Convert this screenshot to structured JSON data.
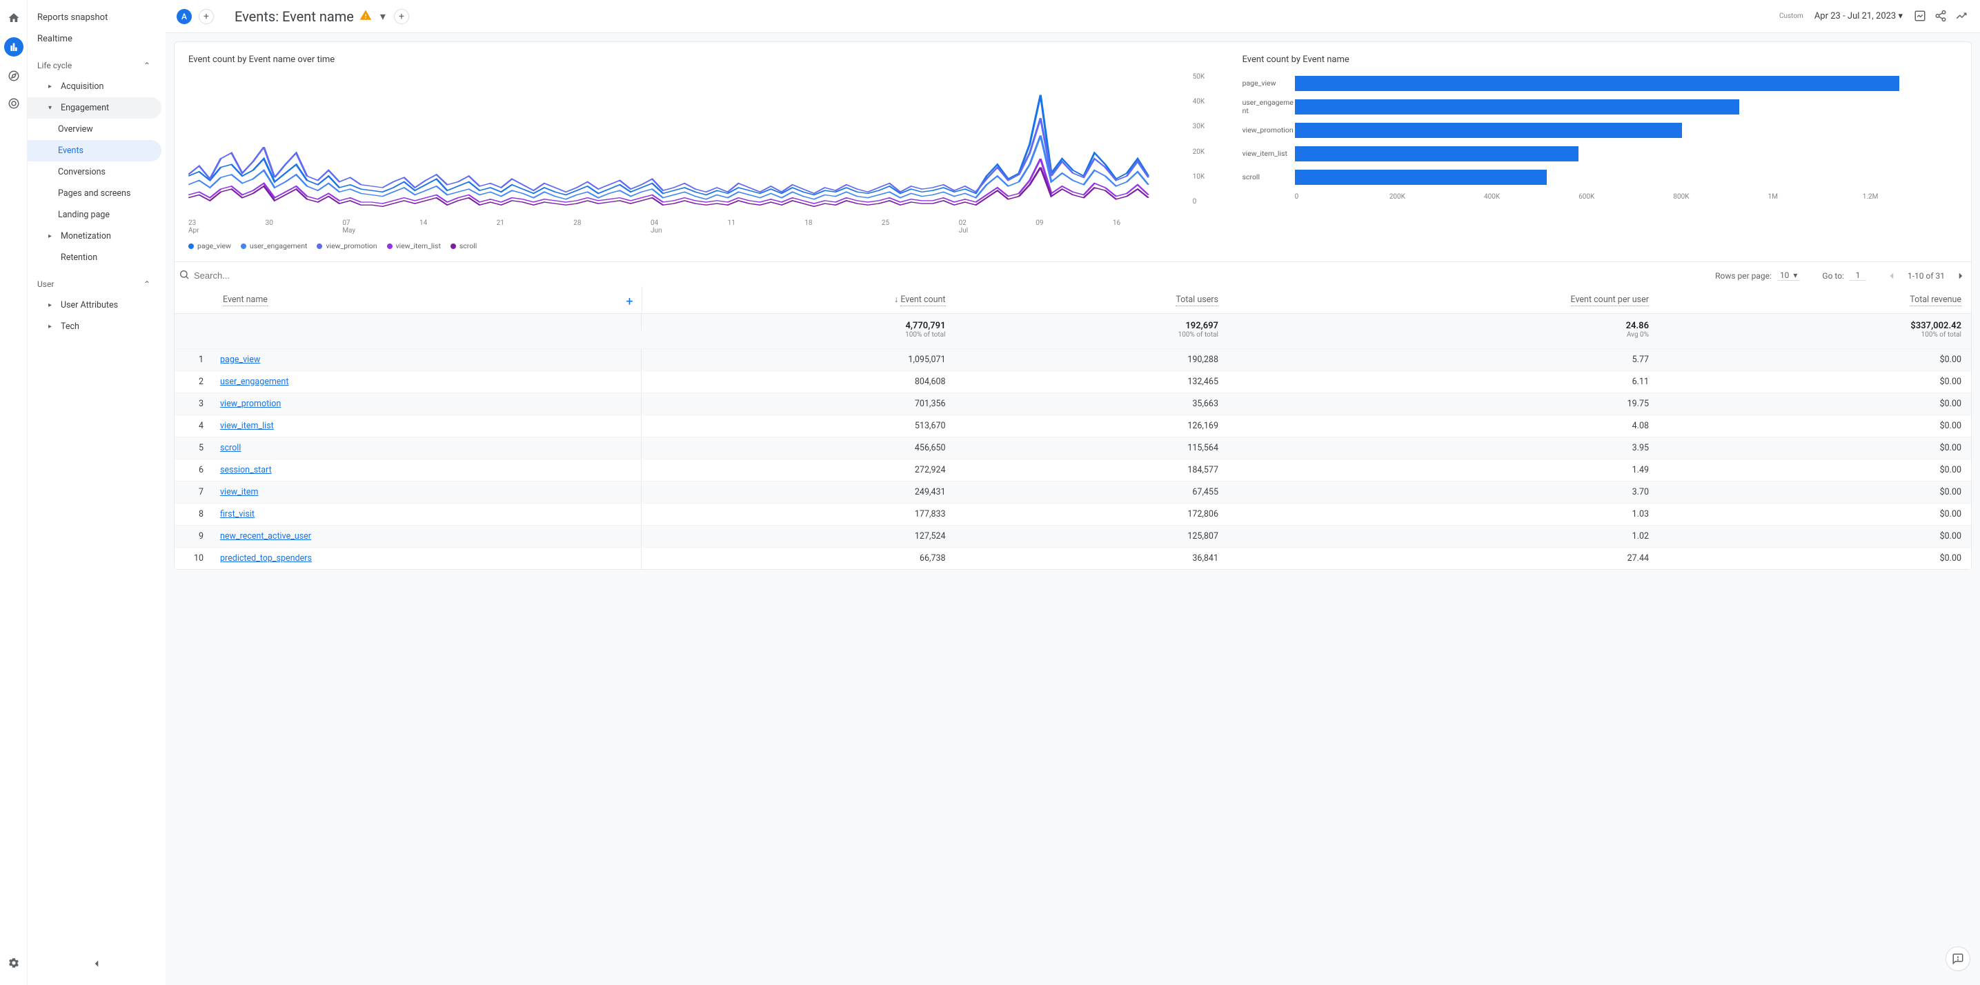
{
  "rail": {
    "icons": [
      "home",
      "reports",
      "explore",
      "advertising"
    ],
    "active": 1
  },
  "sidebar": {
    "top": {
      "snapshot": "Reports snapshot",
      "realtime": "Realtime"
    },
    "sections": {
      "lifecycle": {
        "label": "Life cycle",
        "acquisition": "Acquisition",
        "engagement": {
          "label": "Engagement",
          "overview": "Overview",
          "events": "Events",
          "conversions": "Conversions",
          "pages": "Pages and screens",
          "landing": "Landing page"
        },
        "monetization": "Monetization",
        "retention": "Retention"
      },
      "user": {
        "label": "User",
        "attributes": "User Attributes",
        "tech": "Tech"
      }
    }
  },
  "header": {
    "segment_chip": "A",
    "title": "Events: Event name",
    "date_label": "Custom",
    "date_range": "Apr 23 - Jul 21, 2023"
  },
  "line_chart_title": "Event count by Event name over time",
  "bar_chart_title": "Event count by Event name",
  "legend": [
    "page_view",
    "user_engagement",
    "view_promotion",
    "view_item_list",
    "scroll"
  ],
  "legend_colors": [
    "#1a73e8",
    "#4285f4",
    "#5e6bf2",
    "#9334e6",
    "#7b1fa2"
  ],
  "chart_data": [
    {
      "type": "line",
      "title": "Event count by Event name over time",
      "ylabel": "",
      "xlabel": "",
      "ylim": [
        0,
        50000
      ],
      "y_ticks": [
        "50K",
        "40K",
        "30K",
        "20K",
        "10K",
        "0"
      ],
      "x_ticks": [
        {
          "d": "23",
          "m": "Apr"
        },
        {
          "d": "30",
          "m": ""
        },
        {
          "d": "07",
          "m": "May"
        },
        {
          "d": "14",
          "m": ""
        },
        {
          "d": "21",
          "m": ""
        },
        {
          "d": "28",
          "m": ""
        },
        {
          "d": "04",
          "m": "Jun"
        },
        {
          "d": "11",
          "m": ""
        },
        {
          "d": "18",
          "m": ""
        },
        {
          "d": "25",
          "m": ""
        },
        {
          "d": "02",
          "m": "Jul"
        },
        {
          "d": "09",
          "m": ""
        },
        {
          "d": "16",
          "m": ""
        }
      ],
      "series": [
        {
          "name": "page_view",
          "color": "#1a73e8",
          "values": [
            14000,
            15500,
            12500,
            17000,
            18000,
            14000,
            16000,
            20000,
            12000,
            15000,
            18000,
            12500,
            11000,
            14000,
            10000,
            11000,
            9500,
            9000,
            8500,
            10000,
            12000,
            9000,
            11000,
            13000,
            9000,
            10500,
            12000,
            9000,
            10000,
            8500,
            11000,
            9500,
            8000,
            10000,
            8500,
            7500,
            9000,
            10500,
            8000,
            9500,
            11000,
            8500,
            10000,
            11500,
            8000,
            9000,
            10000,
            8500,
            7500,
            9000,
            8000,
            10000,
            9000,
            8000,
            9500,
            8000,
            10000,
            8500,
            7500,
            9000,
            8500,
            10000,
            8500,
            8000,
            9000,
            10500,
            8000,
            9500,
            8500,
            9000,
            10000,
            8500,
            9500,
            8000,
            14000,
            18000,
            13000,
            15000,
            25000,
            42000,
            15000,
            20000,
            16000,
            14000,
            22000,
            18000,
            13000,
            15000,
            20000,
            14000
          ]
        },
        {
          "name": "user_engagement",
          "color": "#4285f4",
          "values": [
            11000,
            12500,
            10000,
            13500,
            14500,
            11500,
            13000,
            16000,
            10000,
            12000,
            14500,
            10500,
            9000,
            11500,
            8500,
            9500,
            8000,
            7500,
            7000,
            8500,
            10000,
            7500,
            9000,
            10500,
            7500,
            8500,
            9500,
            7500,
            8500,
            7000,
            9000,
            8000,
            6500,
            8500,
            7000,
            6000,
            7500,
            8500,
            6500,
            8000,
            9000,
            7000,
            8500,
            9500,
            6500,
            7500,
            8500,
            7000,
            6000,
            7500,
            6500,
            8500,
            7500,
            6500,
            8000,
            6500,
            8500,
            7000,
            6000,
            7500,
            7000,
            8500,
            7000,
            6500,
            7500,
            8500,
            6500,
            8000,
            7000,
            7500,
            8500,
            7000,
            8000,
            6500,
            11000,
            14000,
            10500,
            12000,
            18000,
            28000,
            12000,
            15000,
            12500,
            11000,
            16000,
            14000,
            10500,
            12000,
            15500,
            11000
          ]
        },
        {
          "name": "view_promotion",
          "color": "#5e6bf2",
          "values": [
            14500,
            17500,
            13000,
            20000,
            22000,
            15000,
            19000,
            24000,
            13500,
            18000,
            22000,
            14000,
            12500,
            16000,
            12000,
            13500,
            11000,
            10500,
            10000,
            12000,
            13500,
            10000,
            12500,
            14500,
            11000,
            12000,
            14000,
            10500,
            11500,
            10000,
            13000,
            11000,
            9000,
            11500,
            10000,
            8500,
            10000,
            12000,
            9500,
            11000,
            12500,
            9500,
            11000,
            13000,
            9000,
            10000,
            11500,
            9500,
            8500,
            10000,
            8500,
            11500,
            10000,
            8500,
            10500,
            8500,
            11000,
            9500,
            8000,
            10000,
            9000,
            11000,
            9500,
            8500,
            10000,
            11500,
            8500,
            10500,
            9500,
            10000,
            11000,
            9000,
            10500,
            8500,
            13000,
            17000,
            12500,
            14500,
            22000,
            34000,
            14000,
            19000,
            15000,
            13500,
            20000,
            17000,
            12500,
            14000,
            19000,
            13500
          ]
        },
        {
          "name": "view_item_list",
          "color": "#9334e6",
          "values": [
            7500,
            8500,
            6500,
            9500,
            10500,
            7500,
            9000,
            11500,
            6500,
            8500,
            10500,
            7000,
            6000,
            8000,
            5500,
            6500,
            5000,
            5000,
            4500,
            5500,
            6500,
            5500,
            6500,
            7500,
            5000,
            6500,
            7500,
            5000,
            6000,
            5000,
            6500,
            6000,
            5000,
            6000,
            5500,
            5000,
            5500,
            6500,
            5500,
            6000,
            6500,
            5500,
            6500,
            7500,
            5000,
            5500,
            6500,
            5500,
            5000,
            5500,
            5000,
            6500,
            5500,
            5000,
            6000,
            5000,
            6500,
            5500,
            4500,
            5500,
            5000,
            6500,
            5500,
            5000,
            5500,
            6500,
            5000,
            6000,
            5500,
            5500,
            6500,
            5000,
            6000,
            5000,
            7500,
            10000,
            7000,
            8000,
            12500,
            20000,
            8000,
            10500,
            8500,
            7500,
            11500,
            10000,
            7000,
            8000,
            11000,
            7500
          ]
        },
        {
          "name": "scroll",
          "color": "#7b1fa2",
          "values": [
            6500,
            7500,
            5500,
            8500,
            9500,
            6500,
            8000,
            10500,
            5500,
            7500,
            9500,
            6000,
            5000,
            7000,
            4500,
            5500,
            4000,
            4000,
            3500,
            4500,
            5500,
            4500,
            5500,
            6500,
            4000,
            5500,
            6500,
            4000,
            5000,
            4000,
            5500,
            5000,
            4000,
            5000,
            4500,
            4000,
            4500,
            5500,
            4500,
            5000,
            5500,
            4500,
            5500,
            6500,
            4000,
            4500,
            5500,
            4500,
            4000,
            4500,
            4000,
            5500,
            4500,
            4000,
            5000,
            4000,
            5500,
            4500,
            3500,
            4500,
            4000,
            5500,
            4500,
            4000,
            4500,
            5500,
            4000,
            5000,
            4500,
            4500,
            5500,
            4000,
            5000,
            4000,
            6500,
            9000,
            6000,
            7000,
            11000,
            17000,
            7000,
            9500,
            7500,
            6500,
            10000,
            9000,
            6000,
            7000,
            9500,
            6500
          ]
        }
      ]
    },
    {
      "type": "bar",
      "title": "Event count by Event name",
      "orientation": "horizontal",
      "xlim": [
        0,
        1200000
      ],
      "x_ticks": [
        "0",
        "200K",
        "400K",
        "600K",
        "800K",
        "1M",
        "1.2M"
      ],
      "categories": [
        "page_view",
        "user_engagement",
        "view_promotion",
        "view_item_list",
        "scroll"
      ],
      "values": [
        1095071,
        804608,
        701356,
        513670,
        456650
      ]
    }
  ],
  "table": {
    "search_placeholder": "Search...",
    "rows_per_page_label": "Rows per page:",
    "rows_per_page_value": "10",
    "goto_label": "Go to:",
    "goto_value": "1",
    "range_text": "1-10 of 31",
    "columns": [
      "Event name",
      "Event count",
      "Total users",
      "Event count per user",
      "Total revenue"
    ],
    "sort_icon_col": 1,
    "totals": {
      "event_count": {
        "val": "4,770,791",
        "sub": "100% of total"
      },
      "total_users": {
        "val": "192,697",
        "sub": "100% of total"
      },
      "per_user": {
        "val": "24.86",
        "sub": "Avg 0%"
      },
      "revenue": {
        "val": "$337,002.42",
        "sub": "100% of total"
      }
    },
    "rows": [
      {
        "n": 1,
        "name": "page_view",
        "ec": "1,095,071",
        "tu": "190,288",
        "pu": "5.77",
        "rev": "$0.00"
      },
      {
        "n": 2,
        "name": "user_engagement",
        "ec": "804,608",
        "tu": "132,465",
        "pu": "6.11",
        "rev": "$0.00"
      },
      {
        "n": 3,
        "name": "view_promotion",
        "ec": "701,356",
        "tu": "35,663",
        "pu": "19.75",
        "rev": "$0.00"
      },
      {
        "n": 4,
        "name": "view_item_list",
        "ec": "513,670",
        "tu": "126,169",
        "pu": "4.08",
        "rev": "$0.00"
      },
      {
        "n": 5,
        "name": "scroll",
        "ec": "456,650",
        "tu": "115,564",
        "pu": "3.95",
        "rev": "$0.00"
      },
      {
        "n": 6,
        "name": "session_start",
        "ec": "272,924",
        "tu": "184,577",
        "pu": "1.49",
        "rev": "$0.00"
      },
      {
        "n": 7,
        "name": "view_item",
        "ec": "249,431",
        "tu": "67,455",
        "pu": "3.70",
        "rev": "$0.00"
      },
      {
        "n": 8,
        "name": "first_visit",
        "ec": "177,833",
        "tu": "172,806",
        "pu": "1.03",
        "rev": "$0.00"
      },
      {
        "n": 9,
        "name": "new_recent_active_user",
        "ec": "127,524",
        "tu": "125,807",
        "pu": "1.02",
        "rev": "$0.00"
      },
      {
        "n": 10,
        "name": "predicted_top_spenders",
        "ec": "66,738",
        "tu": "36,841",
        "pu": "27.44",
        "rev": "$0.00"
      }
    ]
  }
}
